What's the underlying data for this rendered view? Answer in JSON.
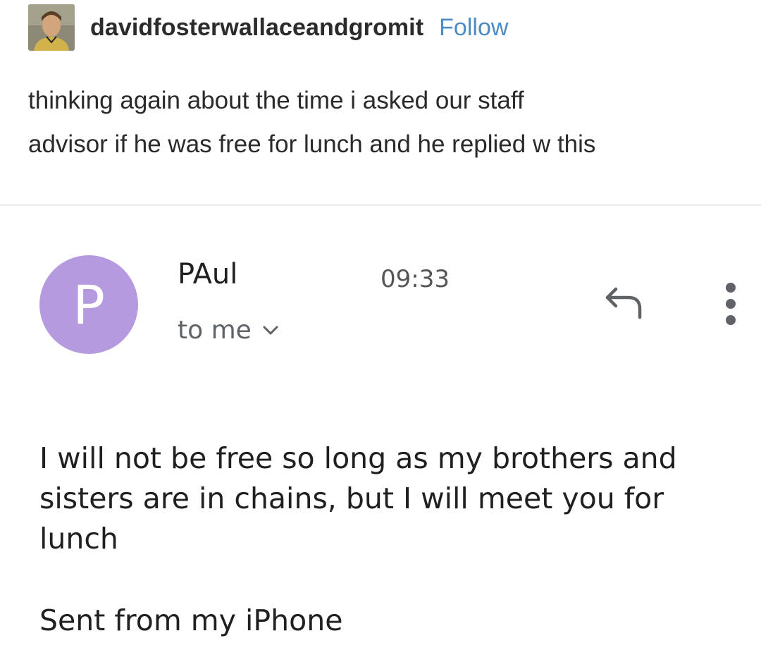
{
  "post": {
    "blog_name": "davidfosterwallaceandgromit",
    "follow_label": "Follow",
    "caption_lines": [
      "thinking again about the time i asked our staff",
      "advisor if he was free for lunch and he replied w this"
    ]
  },
  "email": {
    "avatar_letter": "P",
    "avatar_color": "#b59ae0",
    "sender": "PAul",
    "time": "09:33",
    "recipient": "to me",
    "icons": [
      "chevron-down-icon",
      "reply-icon",
      "more-vertical-icon"
    ],
    "body_lines": [
      "I will not be free so long as my brothers and",
      "sisters are in chains, but I will meet you for",
      "lunch"
    ],
    "signature": "Sent from my iPhone"
  }
}
